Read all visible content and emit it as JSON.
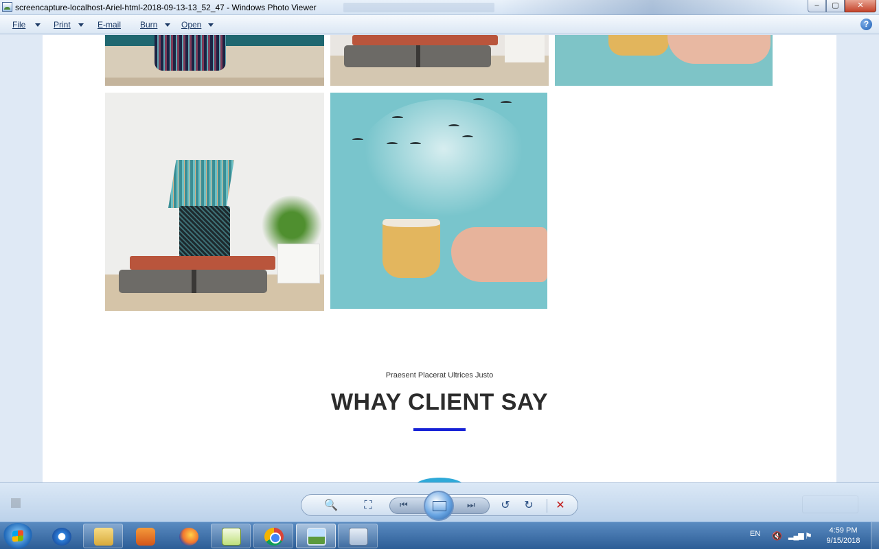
{
  "window": {
    "title": "screencapture-localhost-Ariel-html-2018-09-13-13_52_47 - Windows Photo Viewer",
    "buttons": {
      "minimize": "‒",
      "maximize": "▢",
      "close": "✕"
    }
  },
  "menu": {
    "file": "File",
    "print": "Print",
    "email": "E-mail",
    "burn": "Burn",
    "open": "Open",
    "help": "?"
  },
  "page": {
    "gallery": [
      {
        "name": "pencil-cup-top"
      },
      {
        "name": "books-top"
      },
      {
        "name": "coffee-hand-top"
      },
      {
        "name": "pencils-on-books"
      },
      {
        "name": "coffee-steam-birds"
      }
    ],
    "section_subtitle": "Praesent Placerat Ultrices Justo",
    "section_title": "WHAY CLIENT SAY",
    "accent_color": "#1722d6"
  },
  "viewer_toolbar": {
    "zoom_icon": "🔍",
    "fit_icon": "⛶",
    "previous_icon": "⏮",
    "next_icon": "⏭",
    "rotate_ccw_icon": "↺",
    "rotate_cw_icon": "↻",
    "delete_icon": "✕"
  },
  "taskbar": {
    "language": "EN",
    "time": "4:59 PM",
    "date": "9/15/2018"
  }
}
